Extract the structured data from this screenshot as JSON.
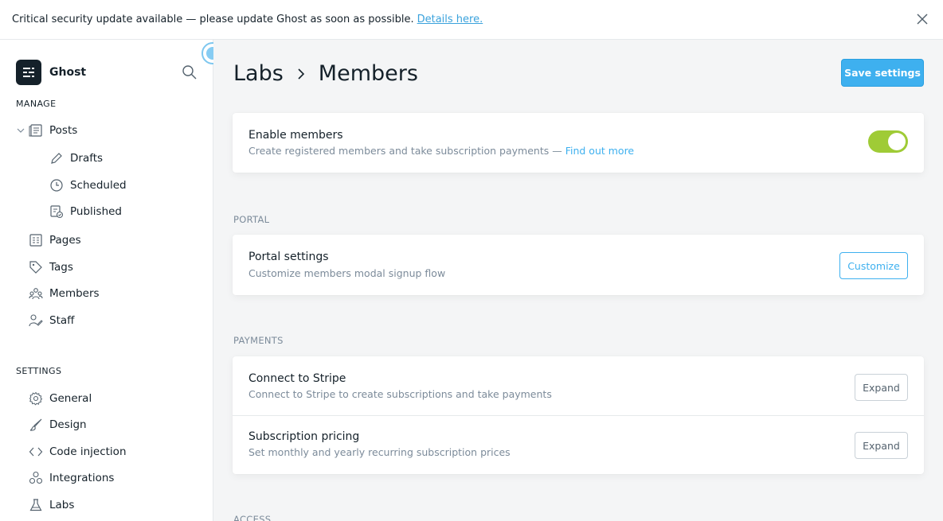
{
  "alert": {
    "message": "Critical security update available — please update Ghost as soon as possible.",
    "link_text": "Details here."
  },
  "sidebar": {
    "brand": "Ghost",
    "manage_title": "MANAGE",
    "settings_title": "SETTINGS",
    "manage_items": [
      {
        "label": "Posts",
        "icon": "posts-icon"
      },
      {
        "label": "Drafts",
        "icon": "pencil-icon"
      },
      {
        "label": "Scheduled",
        "icon": "clock-icon"
      },
      {
        "label": "Published",
        "icon": "published-icon"
      },
      {
        "label": "Pages",
        "icon": "pages-icon"
      },
      {
        "label": "Tags",
        "icon": "tag-icon"
      },
      {
        "label": "Members",
        "icon": "members-icon"
      },
      {
        "label": "Staff",
        "icon": "staff-icon"
      }
    ],
    "settings_items": [
      {
        "label": "General",
        "icon": "gear-icon"
      },
      {
        "label": "Design",
        "icon": "brush-icon"
      },
      {
        "label": "Code injection",
        "icon": "code-icon"
      },
      {
        "label": "Integrations",
        "icon": "integrations-icon"
      },
      {
        "label": "Labs",
        "icon": "flask-icon"
      }
    ]
  },
  "header": {
    "breadcrumb_parent": "Labs",
    "breadcrumb_current": "Members",
    "save_label": "Save settings"
  },
  "enable_members": {
    "title": "Enable members",
    "desc": "Create registered members and take subscription payments —",
    "link": "Find out more",
    "enabled": true
  },
  "portal": {
    "group": "PORTAL",
    "title": "Portal settings",
    "desc": "Customize members modal signup flow",
    "button": "Customize"
  },
  "payments": {
    "group": "PAYMENTS",
    "rows": [
      {
        "title": "Connect to Stripe",
        "desc": "Connect to Stripe to create subscriptions and take payments",
        "button": "Expand"
      },
      {
        "title": "Subscription pricing",
        "desc": "Set monthly and yearly recurring subscription prices",
        "button": "Expand"
      }
    ]
  },
  "access": {
    "group": "ACCESS"
  },
  "colors": {
    "accent": "#3eb0ef",
    "toggle_on": "#9fcb36",
    "text": "#15212a",
    "muted": "#7c8b9a"
  }
}
